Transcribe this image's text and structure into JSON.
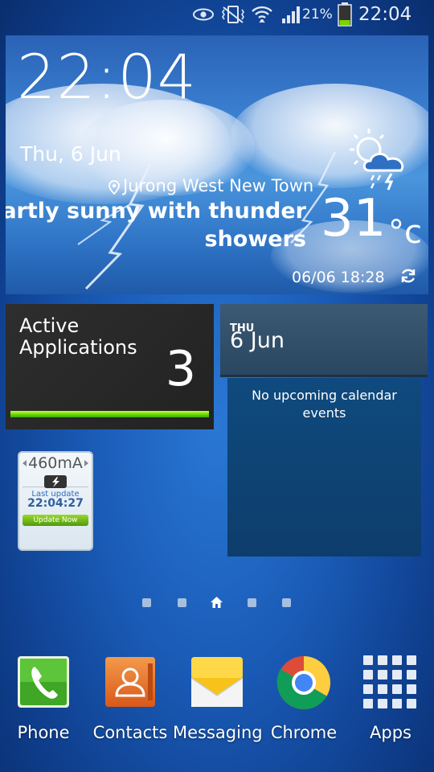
{
  "status_bar": {
    "battery_percent": "21%",
    "time": "22:04",
    "icons": [
      "eye-icon",
      "vibrate-mute-icon",
      "wifi-icon",
      "signal-icon",
      "battery-icon"
    ]
  },
  "weather": {
    "time": "22:04",
    "date": "Thu, 6 Jun",
    "location": "Jurong West New Town",
    "condition_line1": "Partly sunny with thunder",
    "condition_line2": "showers",
    "temperature": "31",
    "unit": "°c",
    "updated": "06/06 18:28",
    "icon": "partly-sunny-thunder-icon"
  },
  "active_apps": {
    "label_line1": "Active",
    "label_line2": "Applications",
    "count": "3",
    "bar_fill": 1.0
  },
  "calendar": {
    "day": "THU",
    "date": "6 Jun",
    "message_line1": "No upcoming calendar",
    "message_line2": "events"
  },
  "battery_widget": {
    "current": "460mA",
    "last_update_label": "Last update",
    "last_update_time": "22:04:27",
    "update_button": "Update Now"
  },
  "page_indicator": {
    "count": 5,
    "active_index": 2
  },
  "dock": [
    {
      "label": "Phone",
      "icon": "phone-icon"
    },
    {
      "label": "Contacts",
      "icon": "contacts-icon"
    },
    {
      "label": "Messaging",
      "icon": "messaging-icon"
    },
    {
      "label": "Chrome",
      "icon": "chrome-icon"
    },
    {
      "label": "Apps",
      "icon": "apps-grid-icon"
    }
  ],
  "colors": {
    "accent_green": "#5fd400",
    "wallpaper_blue": "#1a5cb8"
  }
}
